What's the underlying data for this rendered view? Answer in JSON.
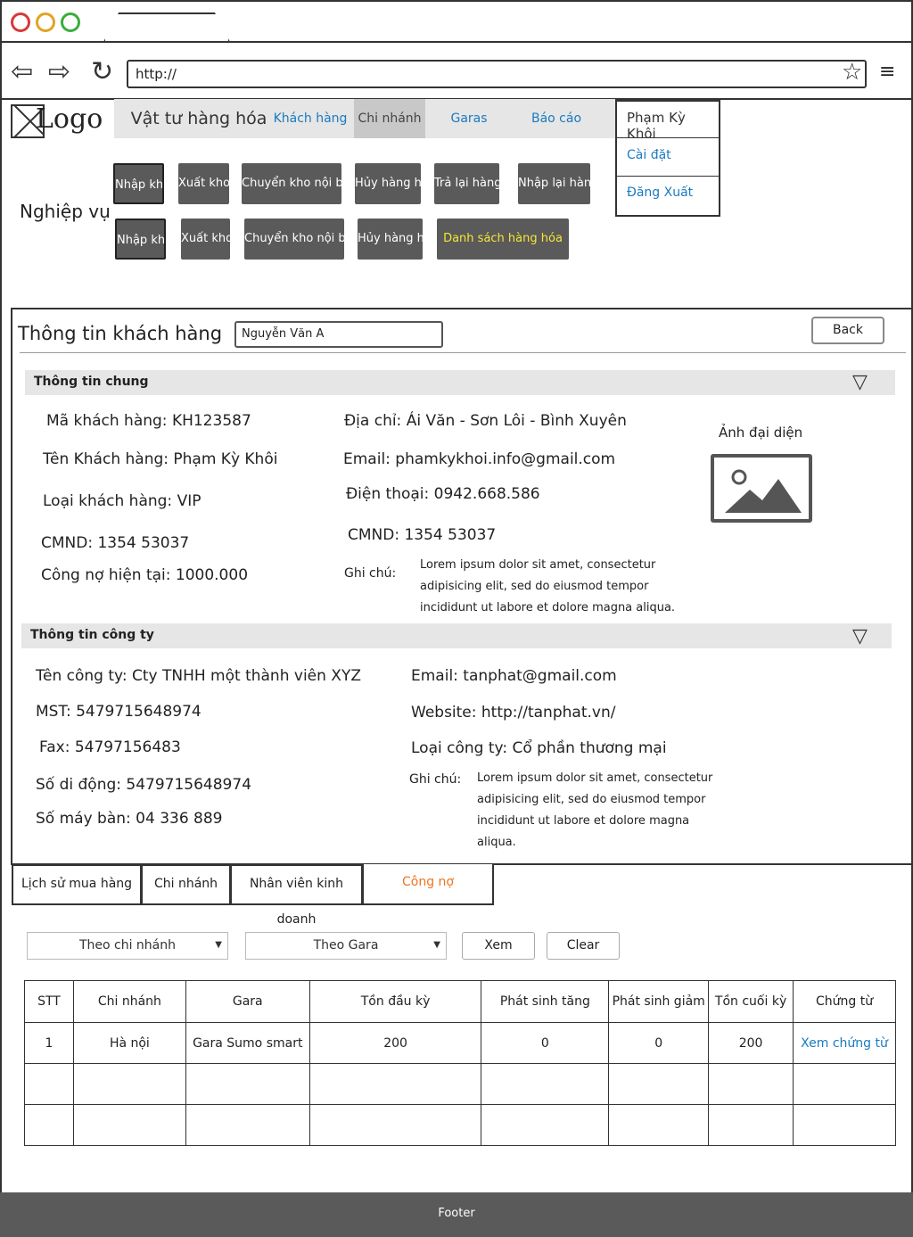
{
  "browser": {
    "url": "http://",
    "dot_colors": [
      "#d73a3a",
      "#e2a422",
      "#3aaf3a"
    ]
  },
  "header": {
    "logo": "Logo",
    "nav": [
      {
        "label": "Vật tư hàng hóa",
        "main": true
      },
      {
        "label": "Khách hàng"
      },
      {
        "label": "Chi nhánh",
        "active": true
      },
      {
        "label": "Garas"
      },
      {
        "label": "Báo cáo"
      }
    ],
    "user_menu": {
      "user": "Phạm Kỳ Khôi",
      "settings": "Cài đặt",
      "logout": "Đăng Xuất"
    }
  },
  "operations": {
    "label": "Nghiệp vụ",
    "row1": [
      "Nhập kho",
      "Xuất kho",
      "Chuyển kho nội bộ",
      "Hủy hàng hóa",
      "Trả lại hàng",
      "Nhập lại hàng"
    ],
    "row2": [
      "Nhập kho",
      "Xuất kho",
      "Chuyển kho nội bộ",
      "Hủy hàng hóa",
      "Danh sách hàng hóa"
    ]
  },
  "customer": {
    "title": "Thông tin khách hàng",
    "name_value": "Nguyễn Văn A",
    "back": "Back",
    "general_section": "Thông  tin chung",
    "code": "Mã khách hàng: KH123587",
    "name": "Tên Khách hàng: Phạm Kỳ Khôi",
    "type": "Loại khách hàng: VIP",
    "id_card": "CMND: 1354 53037",
    "debt": "Công nợ hiện tại: 1000.000",
    "address": "Địa chỉ: Ái Văn - Sơn Lôi - Bình Xuyên",
    "email": "Email: phamkykhoi.info@gmail.com",
    "phone": "Điện thoại: 0942.668.586",
    "id_card2": "CMND: 1354 53037",
    "note_label": "Ghi chú:",
    "note": "Lorem ipsum dolor sit amet, consectetur adipisicing elit, sed do eiusmod tempor incididunt ut labore et dolore magna aliqua.",
    "avatar_label": "Ảnh đại diện"
  },
  "company": {
    "section": "Thông  tin công ty",
    "name": "Tên công ty: Cty TNHH một thành viên XYZ",
    "tax": "MST: 5479715648974",
    "fax": "Fax: 54797156483",
    "mobile": "Số di động: 5479715648974",
    "landline": "Số máy bàn: 04 336 889",
    "email": "Email: tanphat@gmail.com",
    "website": "Website: http://tanphat.vn/",
    "type": "Loại công ty: Cổ phần thương mại",
    "note_label": "Ghi chú:",
    "note": "Lorem ipsum dolor sit amet, consectetur adipisicing elit, sed do eiusmod tempor incididunt ut labore et dolore magna aliqua."
  },
  "tabs": [
    "Lịch sử mua hàng",
    "Chi nhánh",
    "Nhân viên kinh doanh",
    "Công nợ"
  ],
  "filters": {
    "branch": "Theo chi nhánh",
    "gara": "Theo Gara",
    "view": "Xem",
    "clear": "Clear"
  },
  "table": {
    "headers": [
      "STT",
      "Chi nhánh",
      "Gara",
      "Tồn đầu kỳ",
      "Phát sinh tăng",
      "Phát sinh giảm",
      "Tồn cuối kỳ",
      "Chứng từ"
    ],
    "rows": [
      [
        "1",
        "Hà nội",
        "Gara Sumo smart",
        "200",
        "0",
        "0",
        "200",
        "Xem chứng từ"
      ]
    ]
  },
  "footer": "Footer"
}
